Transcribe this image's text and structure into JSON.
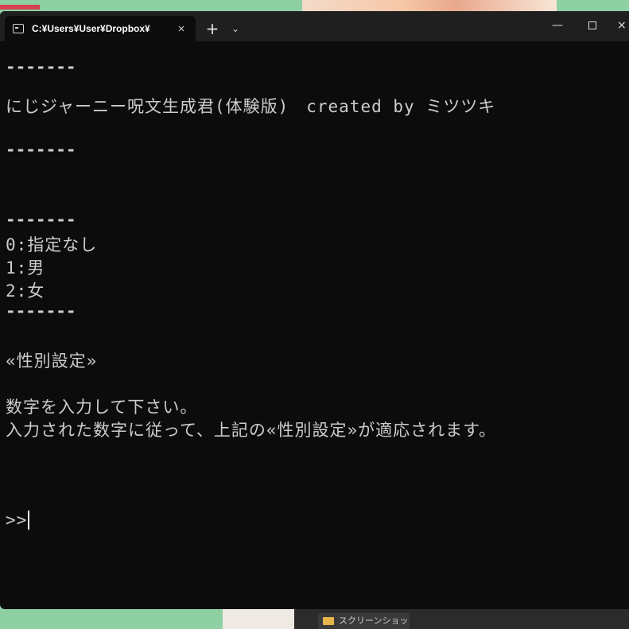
{
  "window": {
    "tab_title": "C:¥Users¥User¥Dropbox¥",
    "tab_close": "×",
    "new_tab": "+",
    "dropdown": "⌄",
    "minimize": "—",
    "close_partial": "×"
  },
  "console": {
    "separator_1": "-------",
    "banner": "にじジャーニー呪文生成君(体験版)　created by ミツツキ",
    "separator_2": "-------",
    "separator_3": "-------",
    "option_0": "0:指定なし",
    "option_1": "1:男",
    "option_2": "2:女",
    "separator_4": "-------",
    "section_title": "«性別設定»",
    "instruction_1": "数字を入力して下さい。",
    "instruction_2": "入力された数字に従って、上記の«性別設定»が適応されます。",
    "prompt": ">>"
  },
  "taskbar": {
    "item_label": "スクリーンショット"
  }
}
